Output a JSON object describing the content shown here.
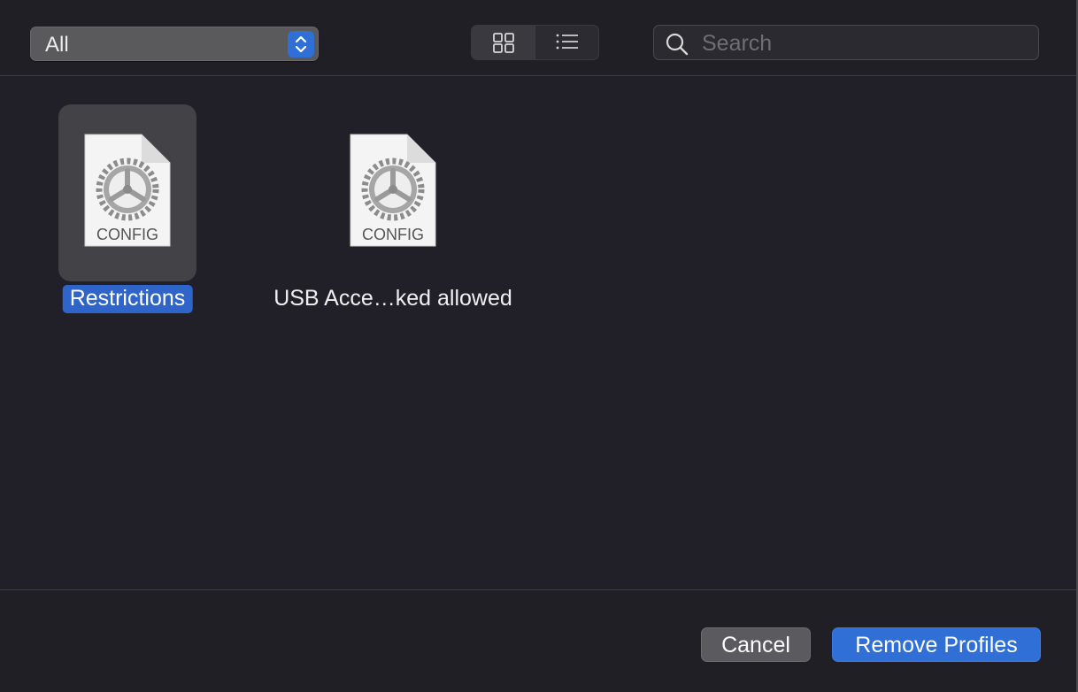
{
  "toolbar": {
    "filter_value": "All",
    "search_placeholder": "Search",
    "view_modes": [
      "grid-view",
      "list-view"
    ]
  },
  "profiles": [
    {
      "name": "Restrictions",
      "badge": "CONFIG",
      "selected": true
    },
    {
      "name": "USB Acce…ked allowed",
      "badge": "CONFIG",
      "selected": false
    }
  ],
  "footer": {
    "cancel_label": "Cancel",
    "primary_label": "Remove Profiles"
  },
  "colors": {
    "accent": "#2f6fd6",
    "background": "#211f28"
  }
}
